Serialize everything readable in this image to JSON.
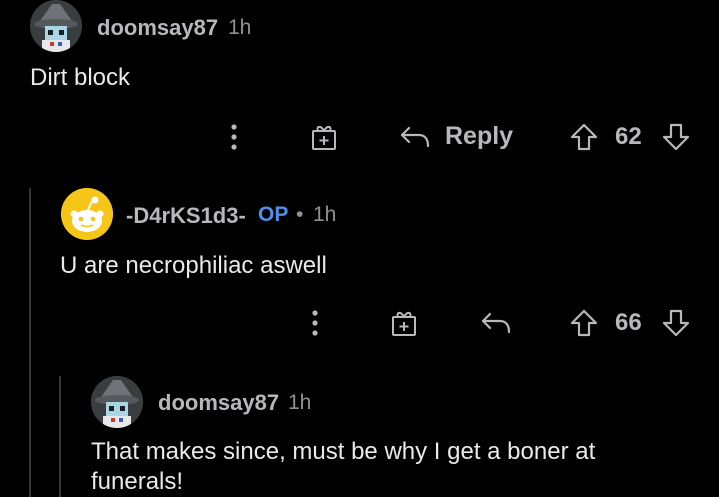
{
  "comments": [
    {
      "username": "doomsay87",
      "time": "1h",
      "body": "Dirt block",
      "actions": {
        "reply_label": "Reply",
        "score": "62"
      }
    },
    {
      "username": "-D4rKS1d3-",
      "op_badge": "OP",
      "separator": "•",
      "time": "1h",
      "body": "U are necrophiliac aswell",
      "actions": {
        "score": "66"
      }
    },
    {
      "username": "doomsay87",
      "time": "1h",
      "body": "That makes since, must be why I get a boner at funerals!"
    }
  ],
  "colors": {
    "background": "#000000",
    "username": "#b6b8ba",
    "op": "#4f8fe8",
    "snoo_avatar_bg": "#f5c518",
    "thread_line": "#343536"
  },
  "icons": [
    "more-options-icon",
    "award-gift-icon",
    "reply-arrow-icon",
    "upvote-icon",
    "downvote-icon",
    "snoo-avatar",
    "wizard-avatar"
  ]
}
